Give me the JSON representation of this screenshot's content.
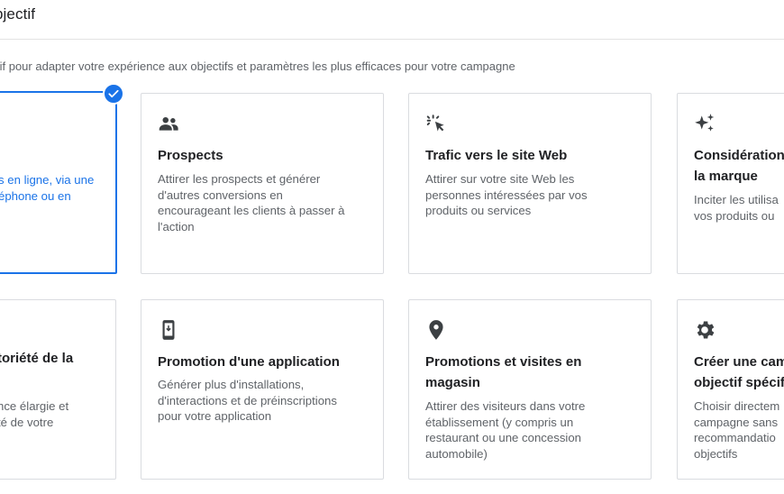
{
  "header": {
    "title": "bjectif"
  },
  "subtitle": "tif pour adapter votre expérience aux objectifs et paramètres les plus efficaces pour votre campagne",
  "colors": {
    "accent": "#1a73e8",
    "border": "#dadce0",
    "text": "#202124",
    "muted": "#5f6368"
  },
  "cards": [
    {
      "icon": "shopping-icon",
      "title": "",
      "desc": "s en ligne, via une\néphone ou en",
      "selected": true
    },
    {
      "icon": "people-icon",
      "title": "Prospects",
      "desc": "Attirer les prospects et générer\nd'autres conversions en\nencourageant les clients à passer à\nl'action"
    },
    {
      "icon": "cursor-click-icon",
      "title": "Trafic vers le site Web",
      "desc": "Attirer sur votre site Web les\npersonnes intéressées par vos\nproduits ou services"
    },
    {
      "icon": "sparkle-icon",
      "title": "Considération\nla marque",
      "desc": "Inciter les utilisa\nvos produits ou"
    },
    {
      "icon": "megaphone-icon",
      "title": "toriété de la",
      "desc": "nce élargie et\nté de votre"
    },
    {
      "icon": "phone-icon",
      "title": "Promotion d'une application",
      "desc": "Générer plus d'installations,\nd'interactions et de préinscriptions\npour votre application"
    },
    {
      "icon": "location-pin-icon",
      "title": "Promotions et visites en\nmagasin",
      "desc": "Attirer des visiteurs dans votre\nétablissement (y compris un\nrestaurant ou une concession\nautomobile)"
    },
    {
      "icon": "gear-icon",
      "title": "Créer une cam\nobjectif spécif",
      "desc": "Choisir directem\ncampagne sans\nrecommandatio\nobjectifs"
    }
  ]
}
